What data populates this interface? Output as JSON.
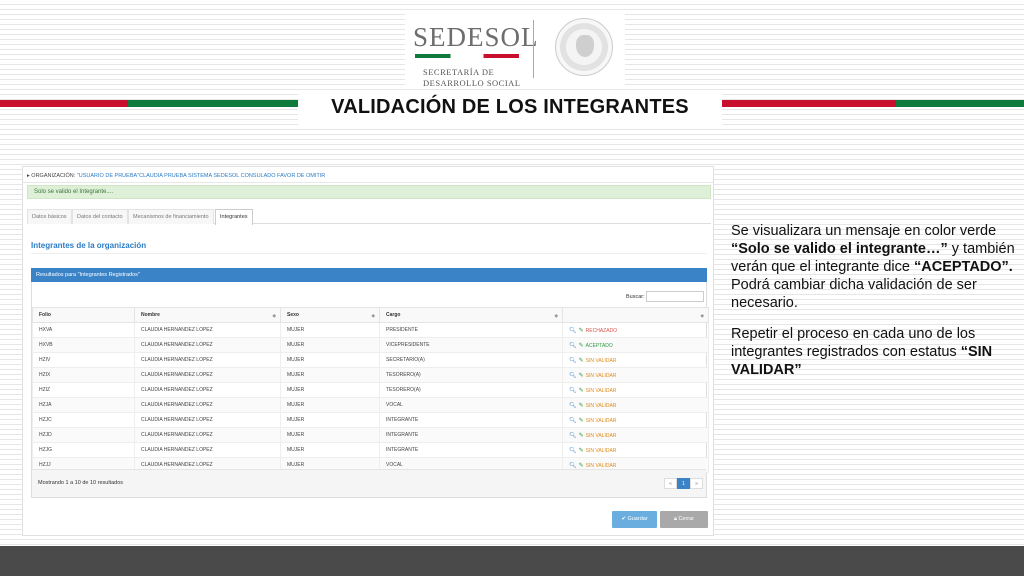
{
  "header": {
    "logo_name": "SEDESOL",
    "logo_sub_line1": "SECRETARÍA DE",
    "logo_sub_line2": "DESARROLLO SOCIAL",
    "title": "VALIDACIÓN DE LOS INTEGRANTES",
    "flag_colors": [
      "#c8102e",
      "#0e7a3c"
    ]
  },
  "app": {
    "org_prefix": "▸ ORGANIZACIÓN: ",
    "org_value": "\"USUARIO DE PRUEBA\"CLAUDIA PRUEBA SISTEMA SEDESOL CONSULADO FAVOR DE OMITIR",
    "alert_text": "Solo se valido el Integrante....",
    "tabs": [
      {
        "label": "Datos básicos"
      },
      {
        "label": "Datos del contacto"
      },
      {
        "label": "Mecanismos de financiamiento"
      },
      {
        "label": "Integrantes"
      }
    ],
    "section_title": "Integrantes de la organización",
    "results_title": "Resultados para \"Integrantes Registrados\"",
    "search_label": "Buscar:",
    "search_value": "",
    "columns": [
      "Folio",
      "Nombre",
      "Sexo",
      "Cargo",
      ""
    ],
    "rows": [
      {
        "folio": "HXVA",
        "nombre": "CLAUDIA HERNANDEZ LOPEZ",
        "sexo": "MUJER",
        "cargo": "PRESIDENTE",
        "status": "RECHAZADO",
        "status_type": "rechazado"
      },
      {
        "folio": "HXVB",
        "nombre": "CLAUDIA HERNANDEZ LOPEZ",
        "sexo": "MUJER",
        "cargo": "VICEPRESIDENTE",
        "status": "ACEPTADO",
        "status_type": "aceptado"
      },
      {
        "folio": "HZIV",
        "nombre": "CLAUDIA HERNANDEZ LOPEZ",
        "sexo": "MUJER",
        "cargo": "SECRETARIO(A)",
        "status": "SIN VALIDAR",
        "status_type": "sin"
      },
      {
        "folio": "HZIX",
        "nombre": "CLAUDIA HERNANDEZ LOPEZ",
        "sexo": "MUJER",
        "cargo": "TESORERO(A)",
        "status": "SIN VALIDAR",
        "status_type": "sin"
      },
      {
        "folio": "HZIZ",
        "nombre": "CLAUDIA HERNANDEZ LOPEZ",
        "sexo": "MUJER",
        "cargo": "TESORERO(A)",
        "status": "SIN VALIDAR",
        "status_type": "sin"
      },
      {
        "folio": "HZJA",
        "nombre": "CLAUDIA HERNANDEZ LOPEZ",
        "sexo": "MUJER",
        "cargo": "VOCAL",
        "status": "SIN VALIDAR",
        "status_type": "sin"
      },
      {
        "folio": "HZJC",
        "nombre": "CLAUDIA HERNANDEZ LOPEZ",
        "sexo": "MUJER",
        "cargo": "INTEGRANTE",
        "status": "SIN VALIDAR",
        "status_type": "sin"
      },
      {
        "folio": "HZJD",
        "nombre": "CLAUDIA HERNANDEZ LOPEZ",
        "sexo": "MUJER",
        "cargo": "INTEGRANTE",
        "status": "SIN VALIDAR",
        "status_type": "sin"
      },
      {
        "folio": "HZJG",
        "nombre": "CLAUDIA HERNANDEZ LOPEZ",
        "sexo": "MUJER",
        "cargo": "INTEGRANTE",
        "status": "SIN VALIDAR",
        "status_type": "sin"
      },
      {
        "folio": "HZJJ",
        "nombre": "CLAUDIA HERNANDEZ LOPEZ",
        "sexo": "MUJER",
        "cargo": "VOCAL",
        "status": "SIN VALIDAR",
        "status_type": "sin"
      }
    ],
    "showing_text": "Mostrando 1 a 10 de 10 resultados",
    "pager": {
      "prev": "«",
      "current": "1",
      "next": "»"
    },
    "save_label": "Guardar",
    "close_label": "Cerrar"
  },
  "description": {
    "p1_a": "Se visualizara un mensaje en color verde ",
    "p1_b": "“Solo se valido el integrante…”",
    "p1_c": " y también verán que el integrante dice ",
    "p1_d": "“ACEPTADO”.",
    "p1_e": "  Podrá cambiar dicha validación de ser necesario.",
    "p2_a": "Repetir el proceso en cada uno de los integrantes registrados con estatus ",
    "p2_b": "“SIN VALIDAR”"
  }
}
